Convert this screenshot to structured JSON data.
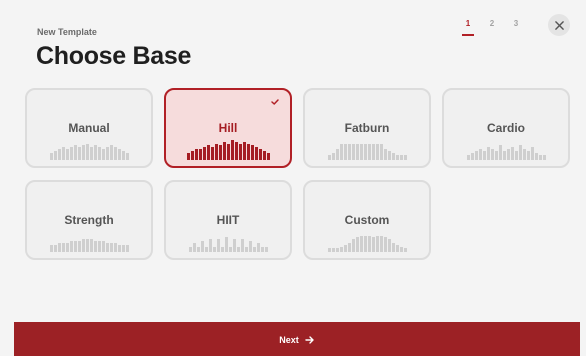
{
  "header": {
    "subtitle": "New Template",
    "title": "Choose Base"
  },
  "steps": [
    "1",
    "2",
    "3"
  ],
  "active_step": 0,
  "close_icon": "close-icon",
  "templates": [
    {
      "label": "Manual",
      "selected": false,
      "profile": [
        4,
        5,
        6,
        7,
        6,
        7,
        8,
        7,
        8,
        9,
        7,
        8,
        7,
        6,
        7,
        8,
        7,
        6,
        5,
        4
      ]
    },
    {
      "label": "Hill",
      "selected": true,
      "profile": [
        4,
        5,
        6,
        6,
        7,
        8,
        7,
        9,
        8,
        10,
        9,
        11,
        10,
        9,
        10,
        9,
        8,
        7,
        6,
        5,
        4
      ]
    },
    {
      "label": "Fatburn",
      "selected": false,
      "profile": [
        3,
        4,
        6,
        9,
        9,
        9,
        9,
        9,
        9,
        9,
        9,
        9,
        9,
        9,
        6,
        5,
        4,
        3,
        3,
        3
      ]
    },
    {
      "label": "Cardio",
      "selected": false,
      "profile": [
        3,
        4,
        5,
        6,
        5,
        7,
        6,
        5,
        8,
        5,
        6,
        7,
        5,
        8,
        6,
        5,
        7,
        4,
        3,
        3
      ]
    },
    {
      "label": "Strength",
      "selected": false,
      "profile": [
        4,
        4,
        5,
        5,
        5,
        6,
        6,
        6,
        7,
        7,
        7,
        6,
        6,
        6,
        5,
        5,
        5,
        4,
        4,
        4
      ]
    },
    {
      "label": "HIIT",
      "selected": false,
      "profile": [
        3,
        5,
        3,
        6,
        3,
        7,
        3,
        7,
        3,
        8,
        3,
        7,
        3,
        7,
        3,
        6,
        3,
        5,
        3,
        3
      ]
    },
    {
      "label": "Custom",
      "selected": false,
      "profile": [
        2,
        2,
        2,
        3,
        4,
        5,
        7,
        8,
        9,
        9,
        9,
        8,
        9,
        9,
        8,
        7,
        5,
        4,
        3,
        2
      ]
    }
  ],
  "check_icon": "check-icon",
  "footer": {
    "next_label": "Next",
    "next_icon": "arrow-right-icon"
  },
  "colors": {
    "accent": "#b12026",
    "button": "#9c2125",
    "selected_fill": "#f6dcdc"
  }
}
